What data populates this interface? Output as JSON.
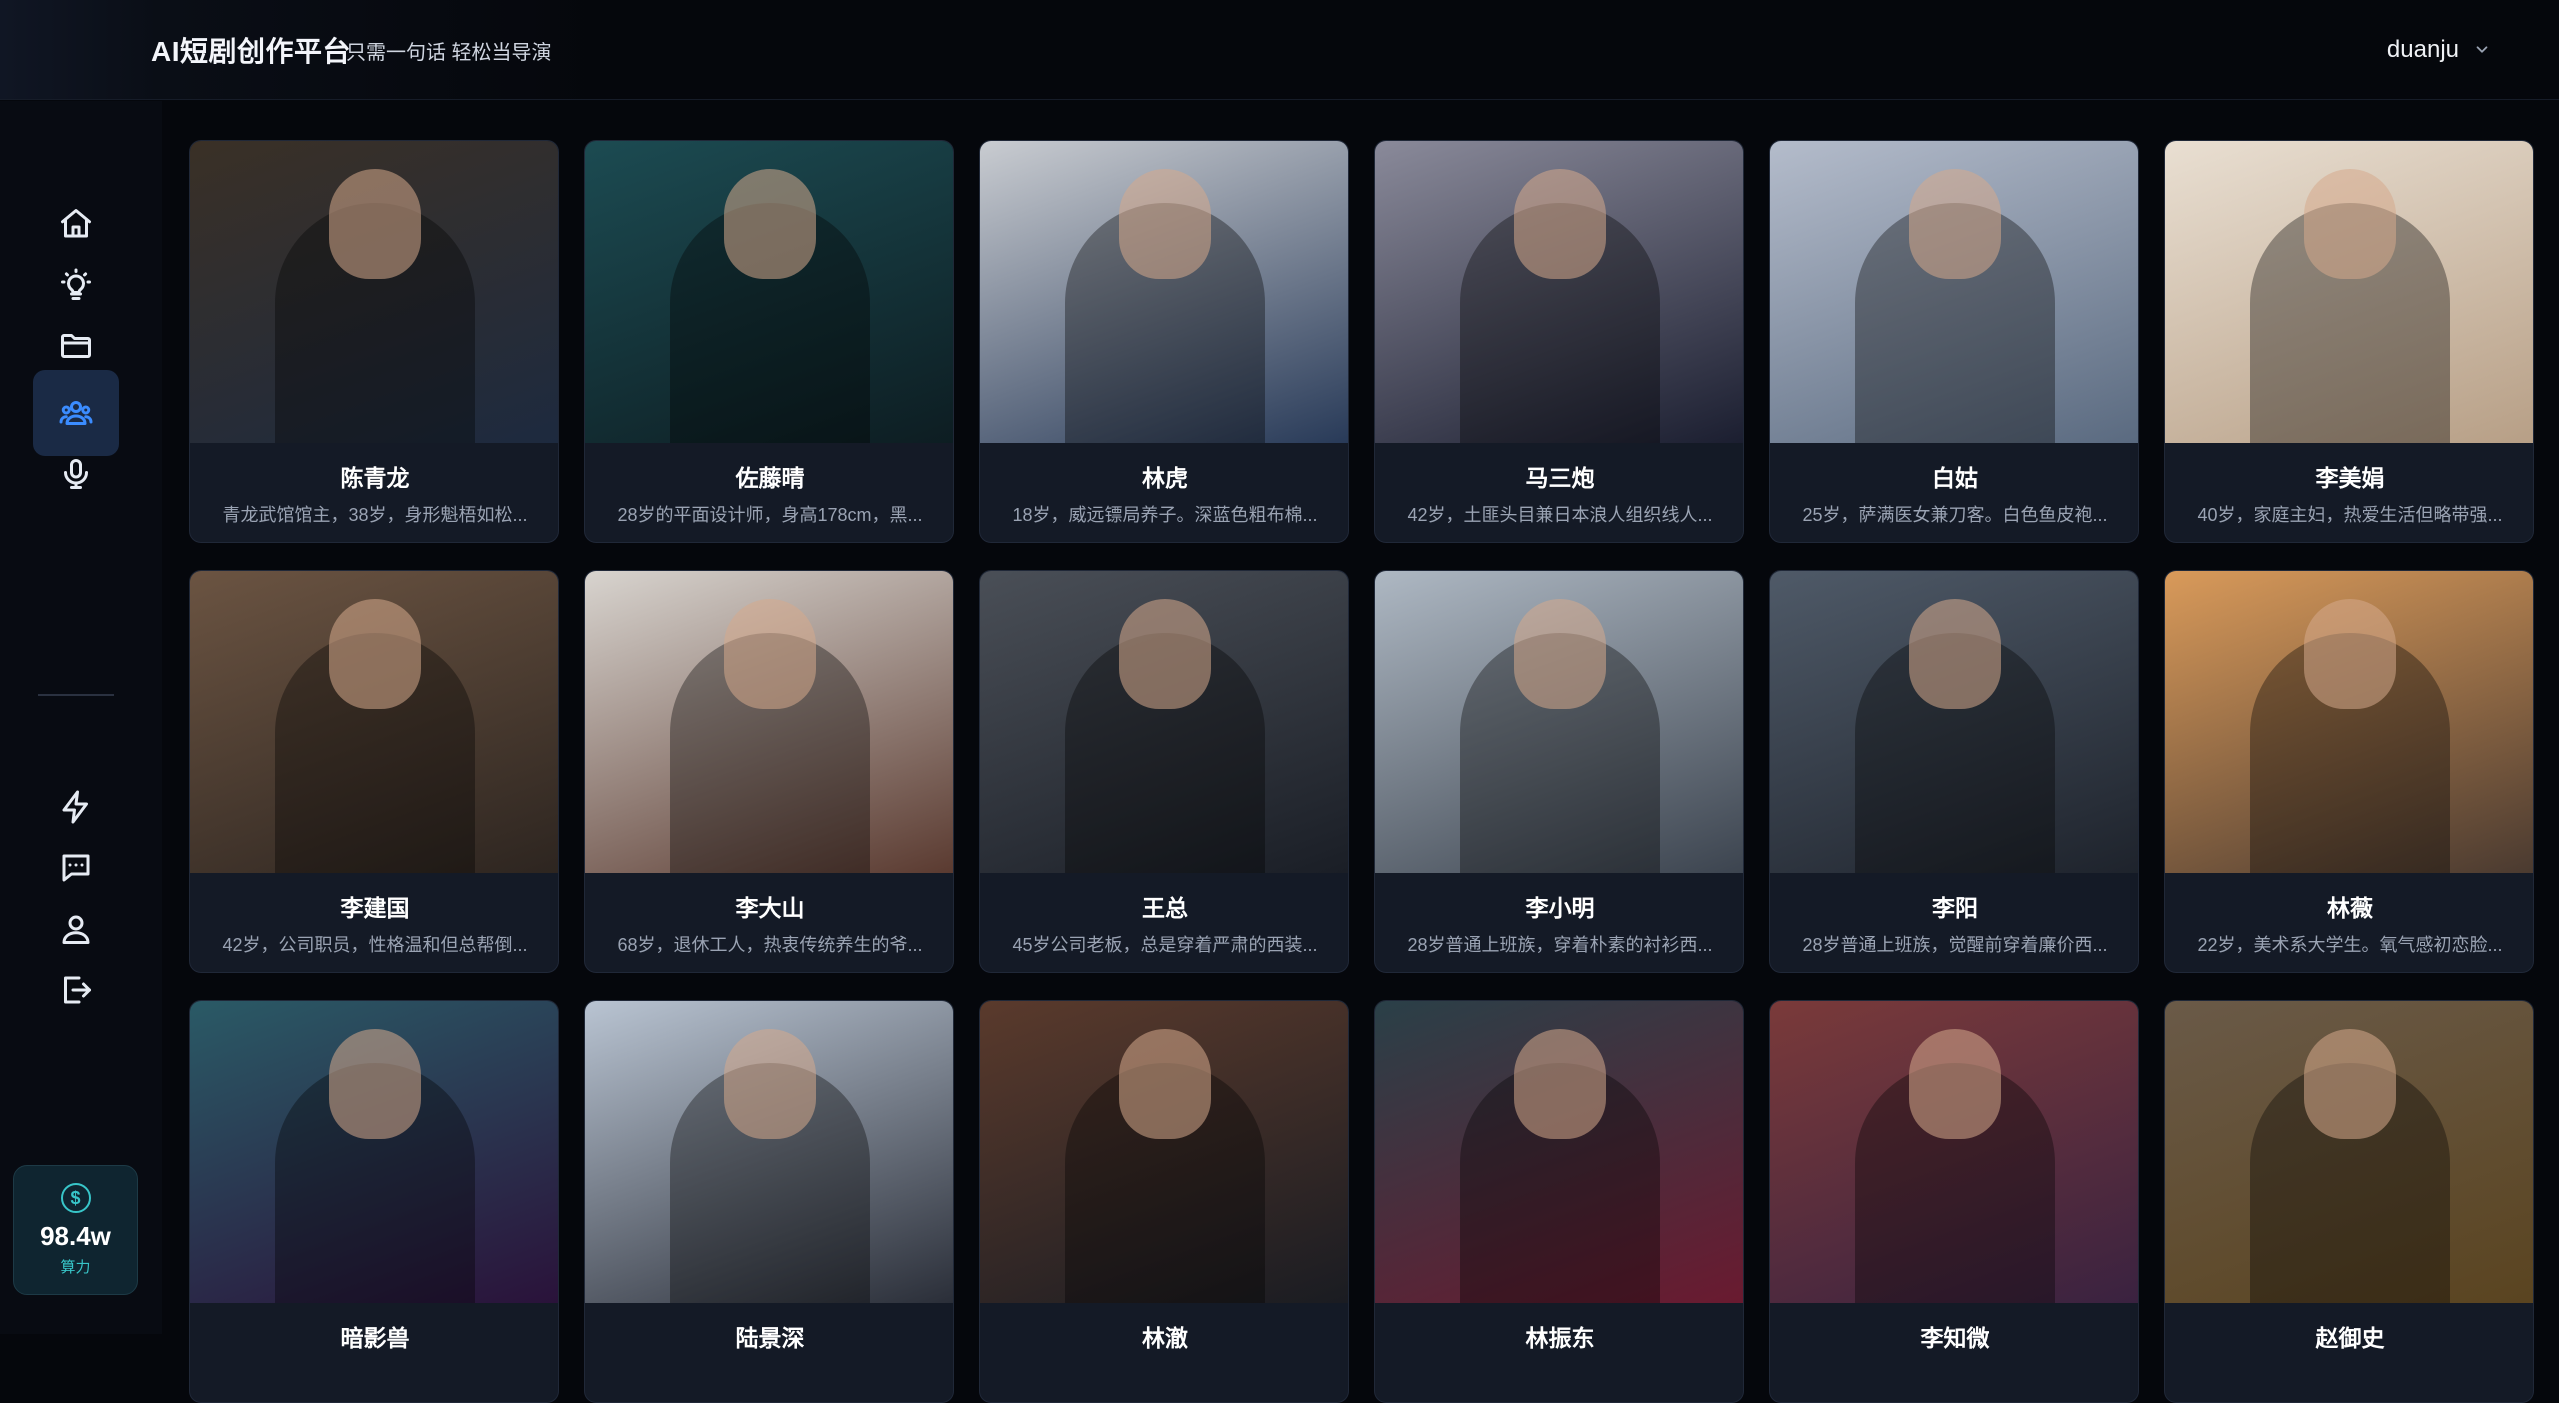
{
  "header": {
    "title": "AI短剧创作平台",
    "slogan": "只需一句话 轻松当导演",
    "username": "duanju"
  },
  "sidebar": {
    "items": [
      {
        "icon": "home-icon",
        "active": false
      },
      {
        "icon": "lightbulb-icon",
        "active": false
      },
      {
        "icon": "folder-icon",
        "active": false
      },
      {
        "icon": "users-icon",
        "active": true
      },
      {
        "icon": "microphone-icon",
        "active": false
      },
      {
        "icon": "lightning-icon",
        "active": false
      },
      {
        "icon": "chat-icon",
        "active": false
      },
      {
        "icon": "user-icon",
        "active": false
      },
      {
        "icon": "logout-icon",
        "active": false
      }
    ],
    "credits": {
      "symbol": "$",
      "amount": "98.4w",
      "label": "算力"
    }
  },
  "characters": [
    {
      "name": "陈青龙",
      "desc": "青龙武馆馆主，38岁，身形魁梧如松...",
      "bg1": "#3a3026",
      "bg2": "#1d2a3f"
    },
    {
      "name": "佐藤晴",
      "desc": "28岁的平面设计师，身高178cm，黑...",
      "bg1": "#1c4b52",
      "bg2": "#0d1d22"
    },
    {
      "name": "林虎",
      "desc": "18岁，威远镖局养子。深蓝色粗布棉...",
      "bg1": "#c9ccd1",
      "bg2": "#283a58"
    },
    {
      "name": "马三炮",
      "desc": "42岁，土匪头目兼日本浪人组织线人...",
      "bg1": "#8a8a9a",
      "bg2": "#1b1e30"
    },
    {
      "name": "白姑",
      "desc": "25岁，萨满医女兼刀客。白色鱼皮袍...",
      "bg1": "#b4bccb",
      "bg2": "#5a6a80"
    },
    {
      "name": "李美娟",
      "desc": "40岁，家庭主妇，热爱生活但略带强...",
      "bg1": "#e9dfd2",
      "bg2": "#b79f86"
    },
    {
      "name": "李建国",
      "desc": "42岁，公司职员，性格温和但总帮倒...",
      "bg1": "#6b5442",
      "bg2": "#2d2520"
    },
    {
      "name": "李大山",
      "desc": "68岁，退休工人，热衷传统养生的爷...",
      "bg1": "#d8d4cf",
      "bg2": "#5a3a30"
    },
    {
      "name": "王总",
      "desc": "45岁公司老板，总是穿着严肃的西装...",
      "bg1": "#4a4f57",
      "bg2": "#1a1e26"
    },
    {
      "name": "李小明",
      "desc": "28岁普通上班族，穿着朴素的衬衫西...",
      "bg1": "#aeb8c3",
      "bg2": "#3c444f"
    },
    {
      "name": "李阳",
      "desc": "28岁普通上班族，觉醒前穿着廉价西...",
      "bg1": "#4f5a68",
      "bg2": "#1e232c"
    },
    {
      "name": "林薇",
      "desc": "22岁，美术系大学生。氧气感初恋脸...",
      "bg1": "#d99a5a",
      "bg2": "#4a3a30"
    },
    {
      "name": "暗影兽",
      "desc": "",
      "bg1": "#2a5a66",
      "bg2": "#2a123a"
    },
    {
      "name": "陆景深",
      "desc": "",
      "bg1": "#b9c4d2",
      "bg2": "#2a2e38"
    },
    {
      "name": "林澈",
      "desc": "",
      "bg1": "#5a3a2c",
      "bg2": "#1a1c22"
    },
    {
      "name": "林振东",
      "desc": "",
      "bg1": "#2a4048",
      "bg2": "#6a1a30"
    },
    {
      "name": "李知微",
      "desc": "",
      "bg1": "#7a3a3a",
      "bg2": "#3a2240"
    },
    {
      "name": "赵御史",
      "desc": "",
      "bg1": "#6a5a48",
      "bg2": "#5a4420"
    }
  ]
}
